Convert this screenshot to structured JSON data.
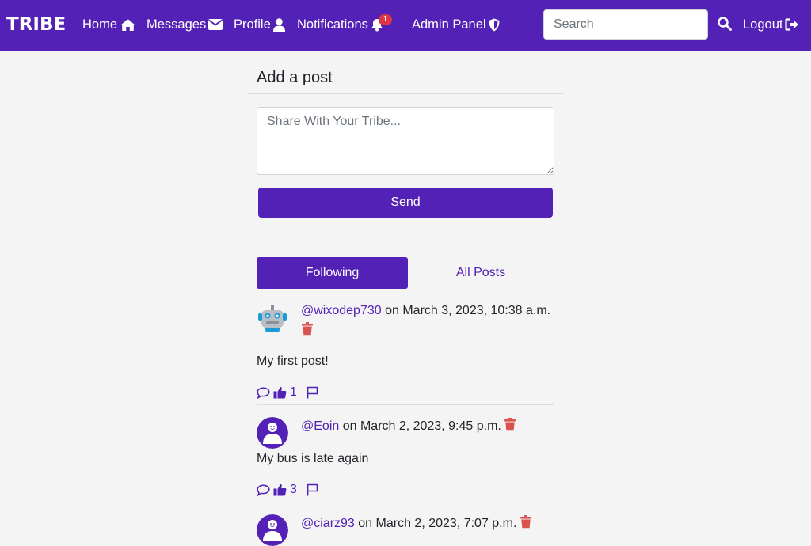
{
  "nav": {
    "brand": "TRIBE",
    "home": "Home",
    "messages": "Messages",
    "profile": "Profile",
    "notifications": "Notifications",
    "notification_count": "1",
    "admin": "Admin Panel",
    "search_placeholder": "Search",
    "logout": "Logout"
  },
  "composer": {
    "title": "Add a post",
    "placeholder": "Share With Your Tribe...",
    "send_label": "Send"
  },
  "tabs": {
    "following": "Following",
    "all_posts": "All Posts"
  },
  "posts": [
    {
      "user": "@wixodep730",
      "date": "on March 3, 2023, 10:38 a.m.",
      "text": "My first post!",
      "likes": "1",
      "avatar": "robot-avatar"
    },
    {
      "user": "@Eoin",
      "date": "on March 2, 2023, 9:45 p.m.",
      "text": "My bus is late again",
      "likes": "3",
      "avatar": "default-avatar"
    },
    {
      "user": "@ciarz93",
      "date": "on March 2, 2023, 7:07 p.m.",
      "text": "",
      "likes": "",
      "avatar": "default-avatar"
    }
  ],
  "colors": {
    "brand": "#5321b5",
    "danger": "#dc3545",
    "background": "#f4f4f4"
  }
}
